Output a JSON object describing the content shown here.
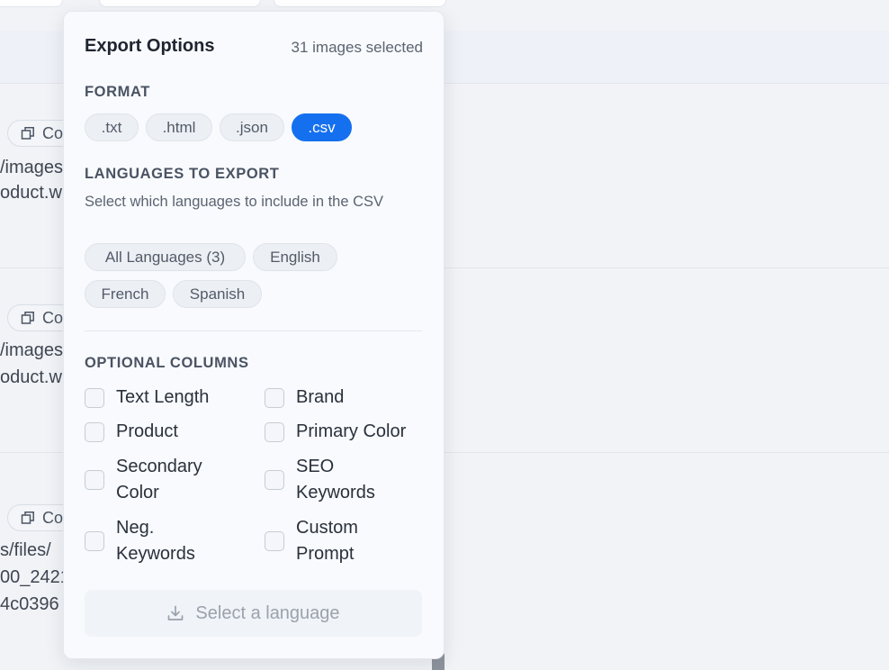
{
  "background": {
    "copy_label": "Co",
    "rows": [
      {
        "lines": [
          "/images",
          "oduct.w"
        ]
      },
      {
        "lines": [
          "/images",
          "oduct.w"
        ]
      },
      {
        "lines": [
          "s/files/",
          "00_2421",
          "4c0396"
        ]
      }
    ]
  },
  "export": {
    "title": "Export Options",
    "count": "31 images selected",
    "format": {
      "label": "FORMAT",
      "options": [
        ".txt",
        ".html",
        ".json",
        ".csv"
      ],
      "selected": ".csv"
    },
    "languages": {
      "label": "LANGUAGES TO EXPORT",
      "description": "Select which languages to include in the CSV",
      "options": [
        "All Languages (3)",
        "English",
        "French",
        "Spanish"
      ]
    },
    "optional_columns": {
      "label": "OPTIONAL COLUMNS",
      "items": [
        {
          "label": "Text Length",
          "checked": false
        },
        {
          "label": "Brand",
          "checked": false
        },
        {
          "label": "Product",
          "checked": false
        },
        {
          "label": "Primary Color",
          "checked": false
        },
        {
          "label": "Secondary Color",
          "checked": false
        },
        {
          "label": "SEO Keywords",
          "checked": false
        },
        {
          "label": "Neg. Keywords",
          "checked": false
        },
        {
          "label": "Custom Prompt",
          "checked": false
        }
      ]
    },
    "action_button": {
      "label": "Select a language",
      "icon": "download-icon",
      "disabled": true
    }
  },
  "colors": {
    "accent": "#1570ef",
    "chip_bg": "#eceff4",
    "disabled_text": "#9aa2ad"
  }
}
